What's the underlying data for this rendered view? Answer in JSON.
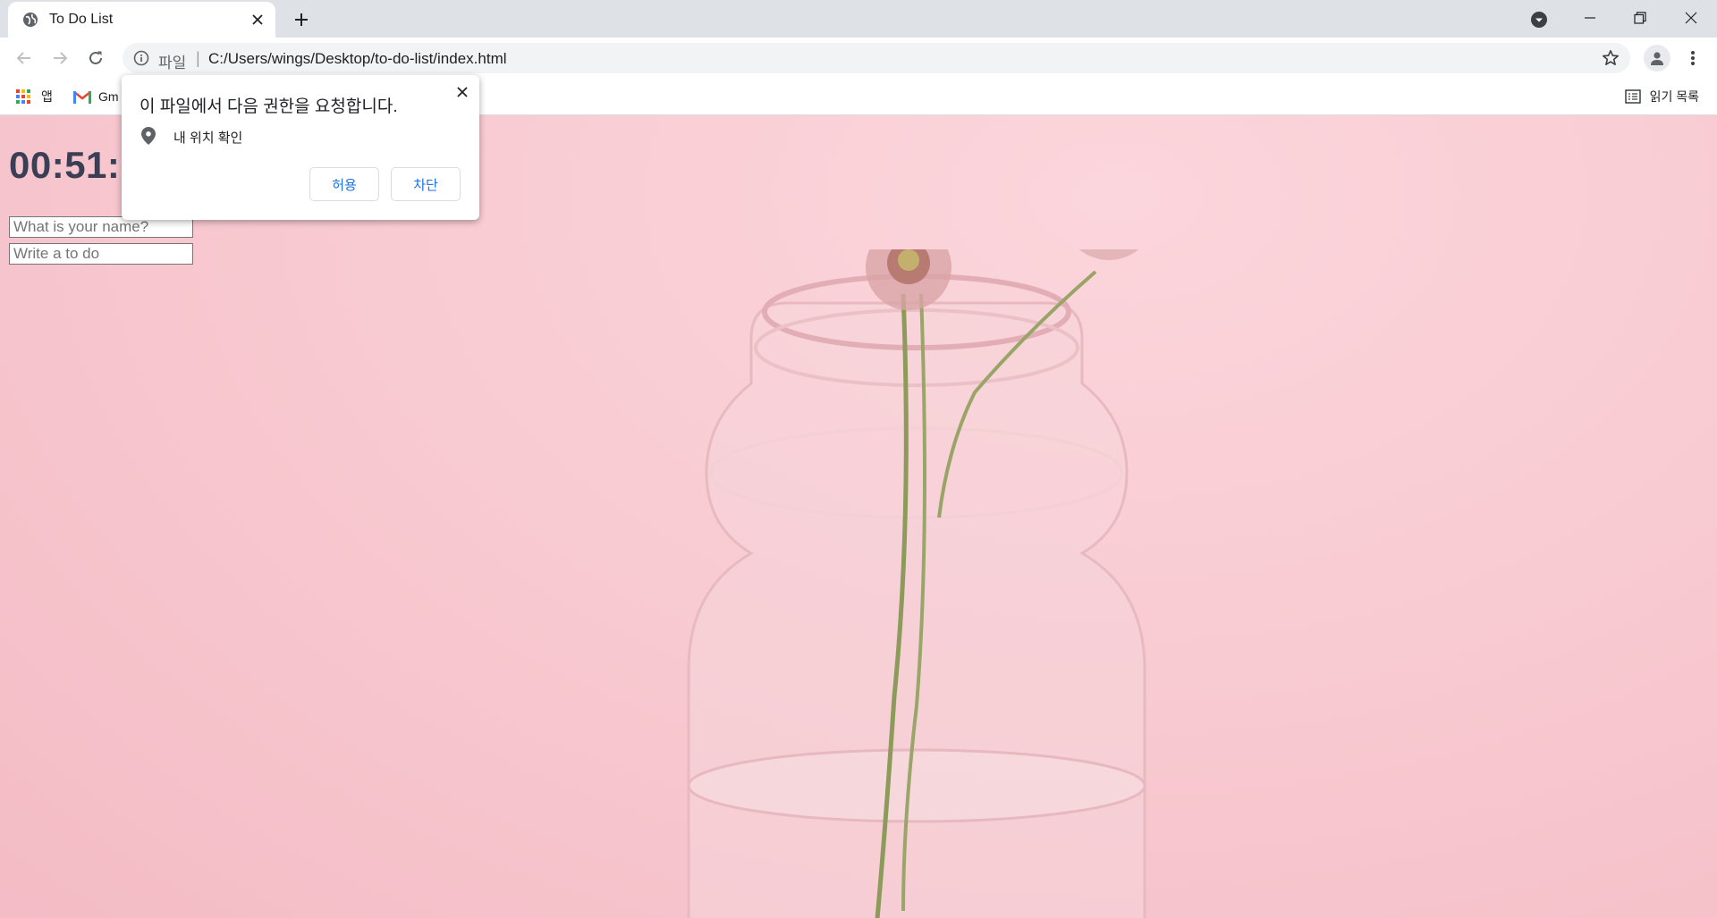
{
  "browser": {
    "tab": {
      "title": "To Do List"
    },
    "omnibox": {
      "scheme": "파일",
      "separator": "|",
      "url": "C:/Users/wings/Desktop/to-do-list/index.html"
    },
    "bookmarks": {
      "apps_label": "앱",
      "gmail_label": "Gm",
      "reading_list_label": "읽기 목록"
    }
  },
  "page": {
    "clock": "00:51:0",
    "name_input": {
      "placeholder": "What is your name?"
    },
    "todo_input": {
      "placeholder": "Write a to do"
    }
  },
  "permission_prompt": {
    "title": "이 파일에서 다음 권한을 요청합니다.",
    "item": "내 위치 확인",
    "allow_label": "허용",
    "block_label": "차단"
  },
  "colors": {
    "background_pink": "#f8c9d0",
    "clock_text": "#3b3f55",
    "link_blue": "#1a73e8"
  }
}
